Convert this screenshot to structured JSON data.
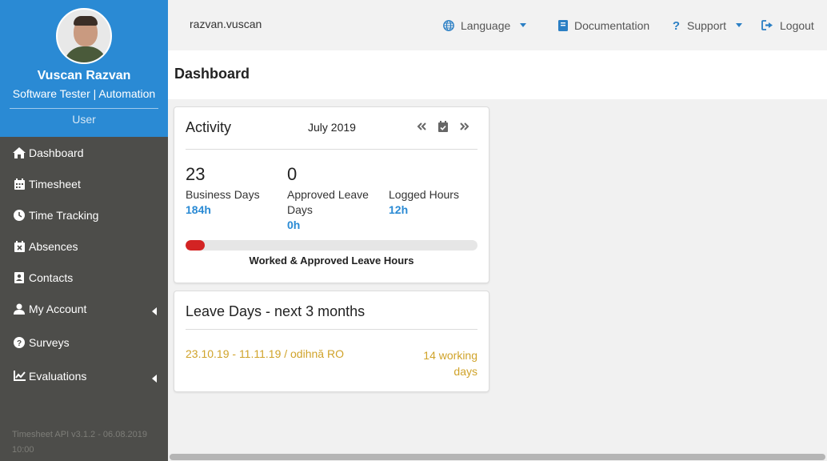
{
  "profile": {
    "name": "Vuscan Razvan",
    "role": "Software Tester | Automation",
    "type": "User"
  },
  "sidebar": {
    "items": [
      {
        "label": "Dashboard",
        "icon": "home-icon"
      },
      {
        "label": "Timesheet",
        "icon": "calendar-icon"
      },
      {
        "label": "Time Tracking",
        "icon": "clock-icon"
      },
      {
        "label": "Absences",
        "icon": "calendar-x-icon"
      },
      {
        "label": "Contacts",
        "icon": "contact-card-icon"
      },
      {
        "label": "My Account",
        "icon": "user-icon"
      },
      {
        "label": "Surveys",
        "icon": "question-circle-icon"
      },
      {
        "label": "Evaluations",
        "icon": "line-chart-icon"
      }
    ],
    "version": "Timesheet API v3.1.2 - 06.08.2019 10:00"
  },
  "topbar": {
    "username": "razvan.vuscan",
    "language": "Language",
    "documentation": "Documentation",
    "support": "Support",
    "logout": "Logout",
    "accent": "#2b7fc4"
  },
  "page": {
    "title": "Dashboard"
  },
  "activity": {
    "title": "Activity",
    "month": "July 2019",
    "stats": [
      {
        "value": "23",
        "label": "Business Days",
        "sub": "184h"
      },
      {
        "value": "0",
        "label": "Approved Leave Days",
        "sub": "0h"
      },
      {
        "value": "",
        "label": "Logged Hours",
        "sub": "12h"
      }
    ],
    "progress_fraction": 0.065,
    "progress_color": "#d32323",
    "progress_caption": "Worked & Approved Leave Hours"
  },
  "leave": {
    "title": "Leave Days - next 3 months",
    "range": "23.10.19 - 11.11.19 / odihnă RO",
    "days": "14 working days",
    "color": "#d0a32a"
  }
}
